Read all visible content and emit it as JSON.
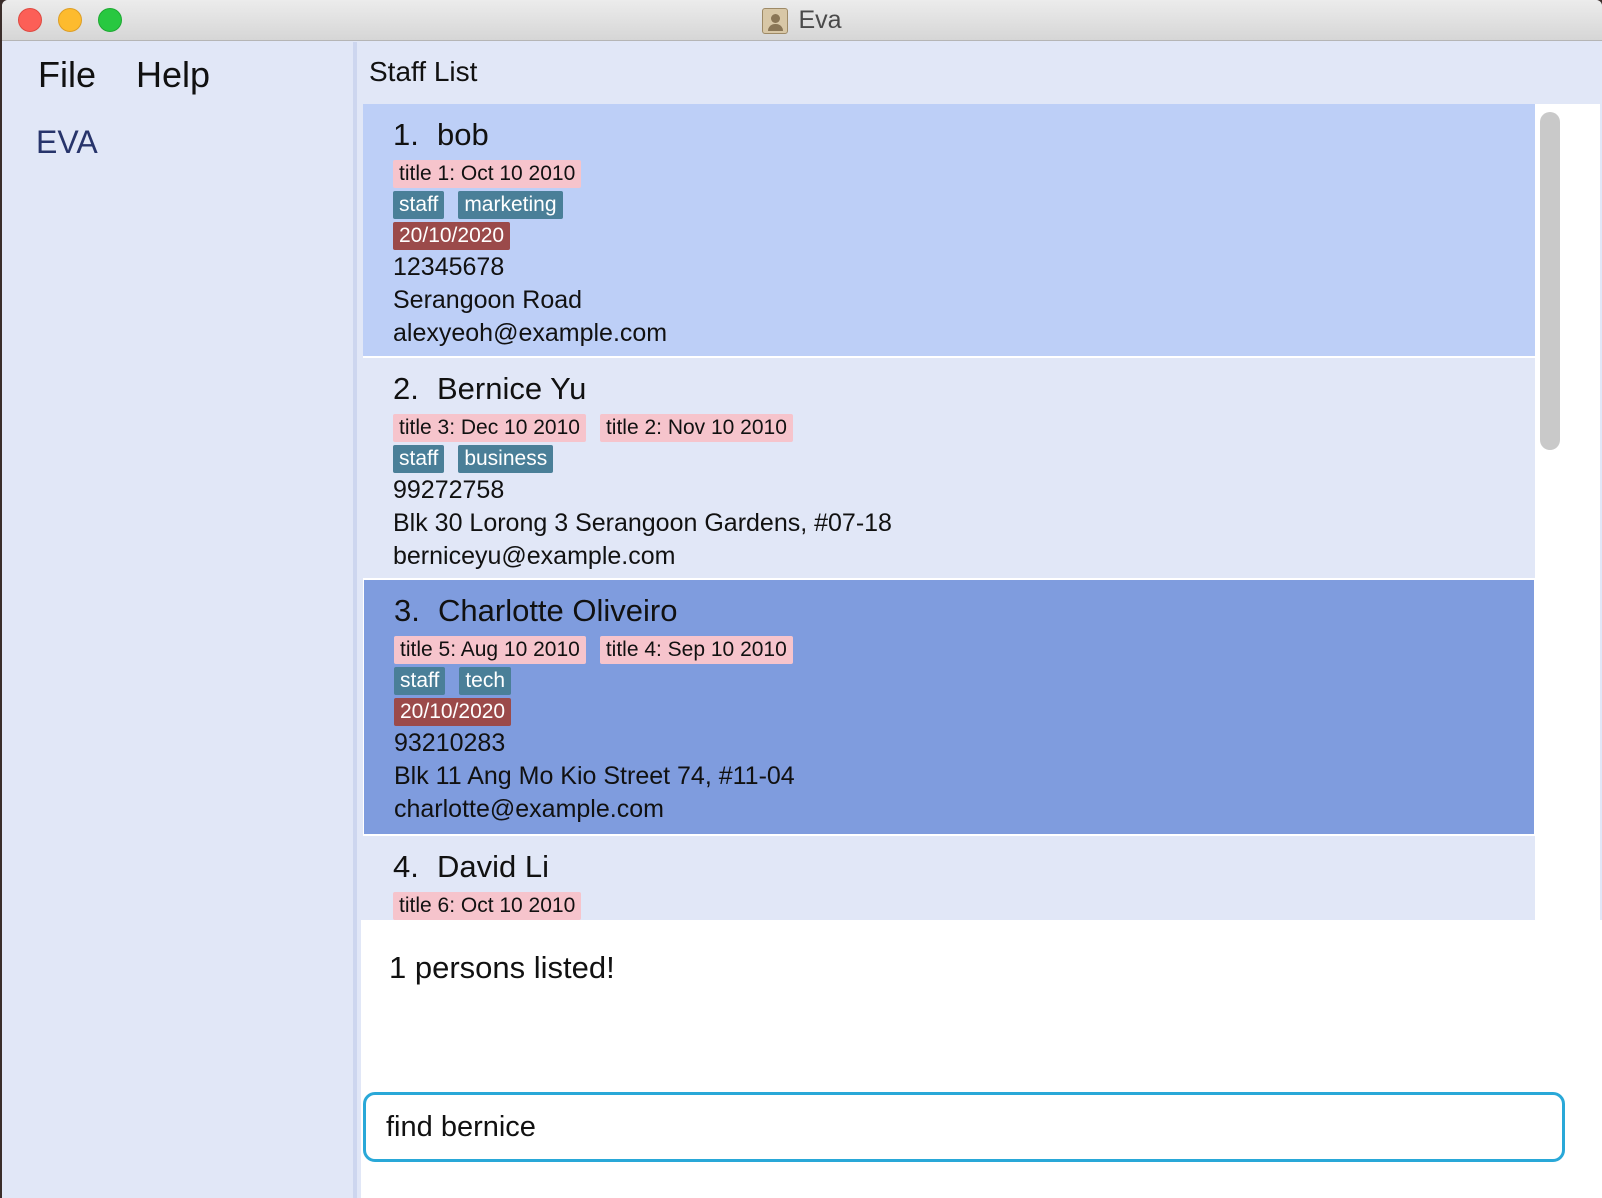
{
  "window": {
    "title": "Eva"
  },
  "menu": {
    "file": "File",
    "help": "Help"
  },
  "sidebar": {
    "app_name": "EVA"
  },
  "panel": {
    "title": "Staff List"
  },
  "persons": [
    {
      "index": "1.",
      "name": "bob",
      "titles": [
        "title 1: Oct 10 2010"
      ],
      "tags": [
        "staff",
        "marketing"
      ],
      "dates": [
        "20/10/2020"
      ],
      "phone": "12345678",
      "address": "Serangoon Road",
      "email": "alexyeoh@example.com"
    },
    {
      "index": "2.",
      "name": "Bernice Yu",
      "titles": [
        "title 3: Dec 10 2010",
        "title 2: Nov 10 2010"
      ],
      "tags": [
        "staff",
        "business"
      ],
      "dates": [],
      "phone": "99272758",
      "address": "Blk 30 Lorong 3 Serangoon Gardens, #07-18",
      "email": "berniceyu@example.com"
    },
    {
      "index": "3.",
      "name": "Charlotte Oliveiro",
      "titles": [
        "title 5: Aug 10 2010",
        "title 4: Sep 10 2010"
      ],
      "tags": [
        "staff",
        "tech"
      ],
      "dates": [
        "20/10/2020"
      ],
      "phone": "93210283",
      "address": "Blk 11 Ang Mo Kio Street 74, #11-04",
      "email": "charlotte@example.com"
    },
    {
      "index": "4.",
      "name": "David Li",
      "titles": [
        "title 6: Oct 10 2010"
      ]
    }
  ],
  "result": {
    "message": "1 persons listed!"
  },
  "command": {
    "value": "find bernice"
  },
  "colors": {
    "selected_card": "#7f9cde",
    "odd_card": "#bdcff7",
    "even_card": "#e1e7f7",
    "title_chip": "#f6c4cc",
    "tag_chip": "#4a7f98",
    "date_chip": "#9b4a4a",
    "input_border": "#29a8d8"
  }
}
